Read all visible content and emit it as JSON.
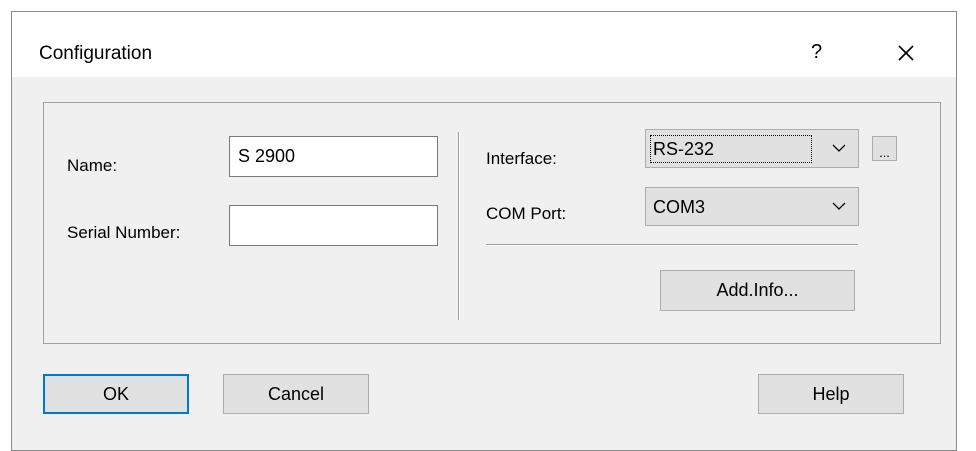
{
  "window": {
    "title": "Configuration",
    "help_label": "?",
    "close_icon": "close-icon"
  },
  "device": {
    "name_label": "Name:",
    "name_value": "S 2900",
    "serial_label": "Serial Number:",
    "serial_value": ""
  },
  "connection": {
    "interface_label": "Interface:",
    "interface_value": "RS-232",
    "browse_label": "...",
    "com_port_label": "COM Port:",
    "com_port_value": "COM3",
    "add_info_label": "Add.Info..."
  },
  "buttons": {
    "ok": "OK",
    "cancel": "Cancel",
    "help": "Help"
  },
  "colors": {
    "dialog_bg": "#f0f0f0",
    "button_bg": "#e1e1e1",
    "default_button_border": "#0078d7"
  }
}
